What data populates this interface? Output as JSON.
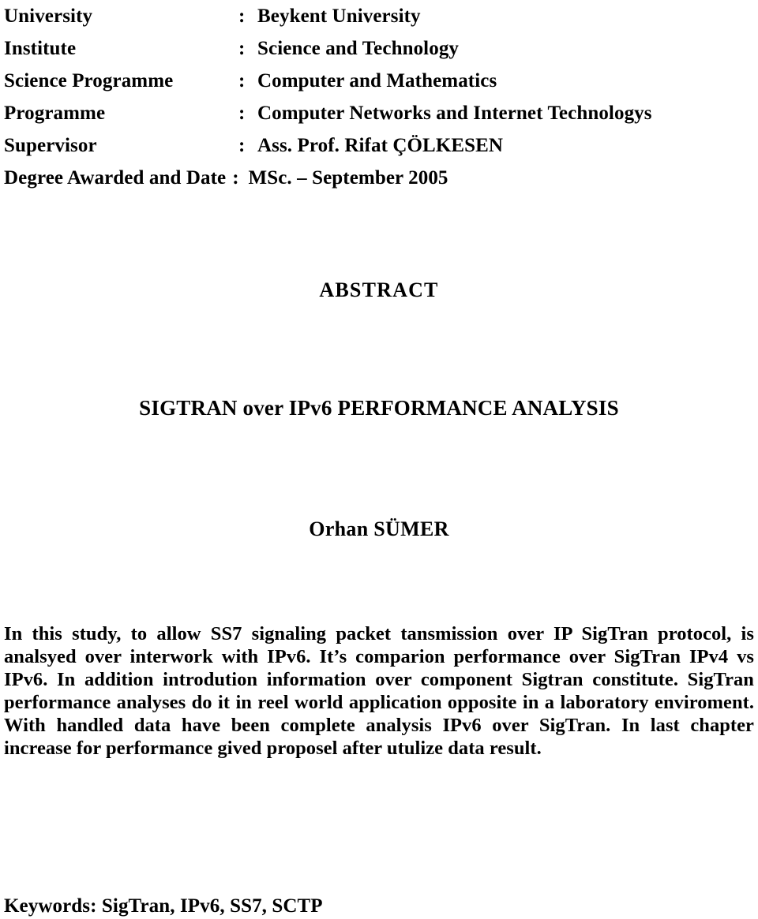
{
  "document": {
    "metadata_rows": [
      {
        "label": "University",
        "separator": ":",
        "value": "Beykent University"
      },
      {
        "label": "Institute",
        "separator": ":",
        "value": "Science and Technology"
      },
      {
        "label": "Science Programme",
        "separator": ":",
        "value": "Computer and Mathematics"
      },
      {
        "label": "Programme",
        "separator": ":",
        "value": "Computer Networks and Internet Technologys"
      },
      {
        "label": "Supervisor",
        "separator": ":",
        "value": "Ass. Prof. Rifat ÇÖLKESEN"
      },
      {
        "label": "Degree Awarded and Date",
        "separator": ":",
        "value": "MSc. – September 2005"
      }
    ],
    "abstract_heading": "ABSTRACT",
    "paper_title": "SIGTRAN over IPv6 PERFORMANCE ANALYSIS",
    "author": "Orhan SÜMER",
    "abstract_body": "In this study, to allow SS7 signaling packet tansmission over IP SigTran protocol, is analsyed over interwork with IPv6. It’s comparion performance over SigTran IPv4 vs IPv6. In addition introdution information over component Sigtran constitute. SigTran performance analyses do it in reel world application opposite in a laboratory enviroment. With handled data have been complete analysis IPv6 over SigTran. In last chapter increase for performance gived proposel after utulize data result.",
    "keywords_line": "Keywords: SigTran, IPv6, SS7, SCTP"
  }
}
